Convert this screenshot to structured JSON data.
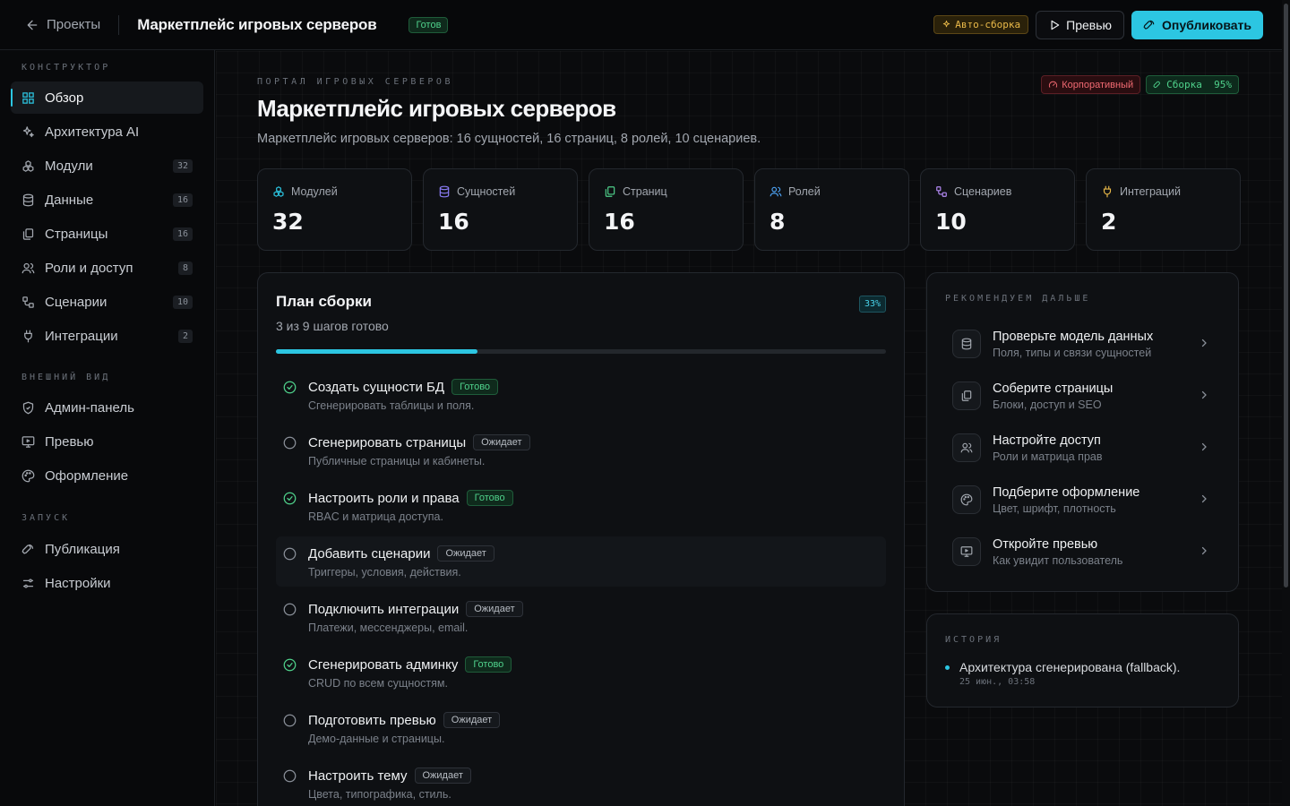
{
  "topbar": {
    "back_label": "Проекты",
    "title": "Маркетплейс игровых серверов",
    "status": "Готов",
    "auto_build": "Авто-сборка",
    "preview": "Превью",
    "publish": "Опубликовать"
  },
  "sidebar": {
    "sections": [
      {
        "label": "КОНСТРУКТОР",
        "items": [
          {
            "label": "Обзор",
            "icon": "dashboard-icon",
            "active": true
          },
          {
            "label": "Архитектура AI",
            "icon": "sparkles-icon"
          },
          {
            "label": "Модули",
            "icon": "modules-icon",
            "count": "32"
          },
          {
            "label": "Данные",
            "icon": "database-icon",
            "count": "16"
          },
          {
            "label": "Страницы",
            "icon": "pages-icon",
            "count": "16"
          },
          {
            "label": "Роли и доступ",
            "icon": "users-icon",
            "count": "8"
          },
          {
            "label": "Сценарии",
            "icon": "workflow-icon",
            "count": "10"
          },
          {
            "label": "Интеграции",
            "icon": "plug-icon",
            "count": "2"
          }
        ]
      },
      {
        "label": "ВНЕШНИЙ ВИД",
        "items": [
          {
            "label": "Админ-панель",
            "icon": "shield-icon"
          },
          {
            "label": "Превью",
            "icon": "monitor-icon"
          },
          {
            "label": "Оформление",
            "icon": "palette-icon"
          }
        ]
      },
      {
        "label": "ЗАПУСК",
        "items": [
          {
            "label": "Публикация",
            "icon": "rocket-icon"
          },
          {
            "label": "Настройки",
            "icon": "settings-icon"
          }
        ]
      }
    ]
  },
  "header": {
    "eyebrow": "ПОРТАЛ ИГРОВЫХ СЕРВЕРОВ",
    "title": "Маркетплейс игровых серверов",
    "subtitle": "Маркетплейс игровых серверов: 16 сущностей, 16 страниц, 8 ролей, 10 сценариев.",
    "tag_corporate": "Корпоративный",
    "tag_build": "Сборка  95%"
  },
  "stats": [
    {
      "label": "Модулей",
      "value": "32",
      "icon": "modules-icon",
      "color": "#2cc6e2"
    },
    {
      "label": "Сущностей",
      "value": "16",
      "icon": "database-icon",
      "color": "#8b7cf6"
    },
    {
      "label": "Страниц",
      "value": "16",
      "icon": "pages-icon",
      "color": "#4fd18b"
    },
    {
      "label": "Ролей",
      "value": "8",
      "icon": "users-icon",
      "color": "#4da3f5"
    },
    {
      "label": "Сценариев",
      "value": "10",
      "icon": "workflow-icon",
      "color": "#b58af6"
    },
    {
      "label": "Интеграций",
      "value": "2",
      "icon": "plug-icon",
      "color": "#e9b949"
    }
  ],
  "plan": {
    "title": "План сборки",
    "subtitle": "3 из 9 шагов готово",
    "percent_label": "33%",
    "progress": 0.33,
    "steps": [
      {
        "name": "Создать сущности БД",
        "desc": "Сгенерировать таблицы и поля.",
        "status": "Готово",
        "done": true
      },
      {
        "name": "Сгенерировать страницы",
        "desc": "Публичные страницы и кабинеты.",
        "status": "Ожидает",
        "done": false
      },
      {
        "name": "Настроить роли и права",
        "desc": "RBAC и матрица доступа.",
        "status": "Готово",
        "done": true
      },
      {
        "name": "Добавить сценарии",
        "desc": "Триггеры, условия, действия.",
        "status": "Ожидает",
        "done": false,
        "highlight": true
      },
      {
        "name": "Подключить интеграции",
        "desc": "Платежи, мессенджеры, email.",
        "status": "Ожидает",
        "done": false
      },
      {
        "name": "Сгенерировать админку",
        "desc": "CRUD по всем сущностям.",
        "status": "Готово",
        "done": true
      },
      {
        "name": "Подготовить превью",
        "desc": "Демо-данные и страницы.",
        "status": "Ожидает",
        "done": false
      },
      {
        "name": "Настроить тему",
        "desc": "Цвета, типографика, стиль.",
        "status": "Ожидает",
        "done": false
      }
    ]
  },
  "recommend": {
    "eyebrow": "РЕКОМЕНДУЕМ ДАЛЬШЕ",
    "items": [
      {
        "title": "Проверьте модель данных",
        "desc": "Поля, типы и связи сущностей",
        "icon": "database-icon"
      },
      {
        "title": "Соберите страницы",
        "desc": "Блоки, доступ и SEO",
        "icon": "pages-icon"
      },
      {
        "title": "Настройте доступ",
        "desc": "Роли и матрица прав",
        "icon": "users-icon"
      },
      {
        "title": "Подберите оформление",
        "desc": "Цвет, шрифт, плотность",
        "icon": "palette-icon"
      },
      {
        "title": "Откройте превью",
        "desc": "Как увидит пользователь",
        "icon": "monitor-icon"
      }
    ]
  },
  "history": {
    "eyebrow": "ИСТОРИЯ",
    "items": [
      {
        "text": "Архитектура сгенерирована (fallback).",
        "time": "25 июн., 03:58"
      }
    ]
  }
}
